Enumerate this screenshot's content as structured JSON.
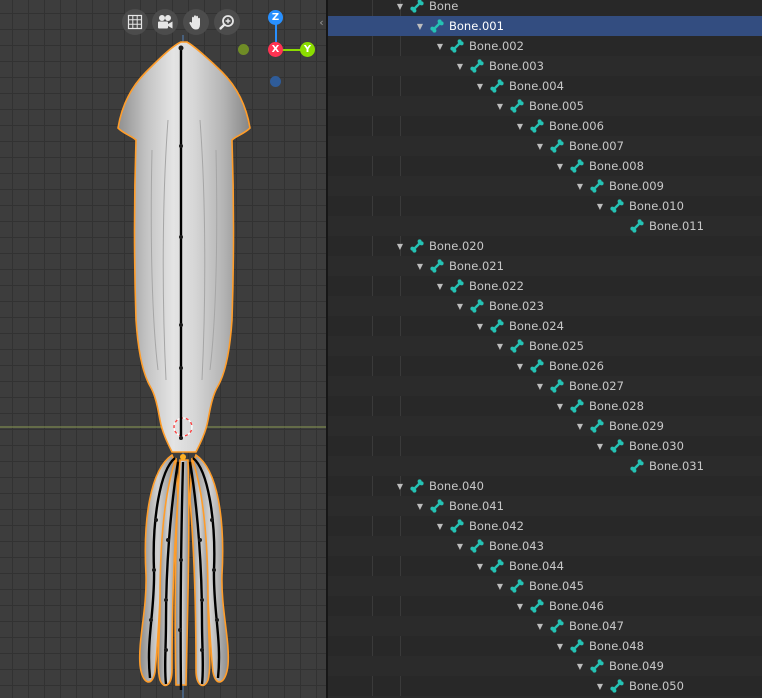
{
  "viewport": {
    "nav_icons": [
      "grid-icon",
      "camera-icon",
      "hand-pan-icon",
      "zoom-icon"
    ],
    "gizmo": {
      "z": "Z",
      "x": "X",
      "y": "Y"
    },
    "colors": {
      "outline": "#ff9d2a",
      "axis_x": "#ff3352",
      "axis_y": "#8bdc00",
      "axis_z": "#2890ff",
      "horizon": "#8a9a54"
    }
  },
  "outliner": {
    "icon": "bone-icon",
    "icon_color": "#25c2b4",
    "selected_bone": "Bone.001",
    "rows": [
      {
        "label": "Bone",
        "depth": 0
      },
      {
        "label": "Bone.001",
        "depth": 1
      },
      {
        "label": "Bone.002",
        "depth": 2
      },
      {
        "label": "Bone.003",
        "depth": 3
      },
      {
        "label": "Bone.004",
        "depth": 4
      },
      {
        "label": "Bone.005",
        "depth": 5
      },
      {
        "label": "Bone.006",
        "depth": 6
      },
      {
        "label": "Bone.007",
        "depth": 7
      },
      {
        "label": "Bone.008",
        "depth": 8
      },
      {
        "label": "Bone.009",
        "depth": 9
      },
      {
        "label": "Bone.010",
        "depth": 10
      },
      {
        "label": "Bone.011",
        "depth": 11
      },
      {
        "label": "Bone.020",
        "depth": 0
      },
      {
        "label": "Bone.021",
        "depth": 1
      },
      {
        "label": "Bone.022",
        "depth": 2
      },
      {
        "label": "Bone.023",
        "depth": 3
      },
      {
        "label": "Bone.024",
        "depth": 4
      },
      {
        "label": "Bone.025",
        "depth": 5
      },
      {
        "label": "Bone.026",
        "depth": 6
      },
      {
        "label": "Bone.027",
        "depth": 7
      },
      {
        "label": "Bone.028",
        "depth": 8
      },
      {
        "label": "Bone.029",
        "depth": 9
      },
      {
        "label": "Bone.030",
        "depth": 10
      },
      {
        "label": "Bone.031",
        "depth": 11
      },
      {
        "label": "Bone.040",
        "depth": 0
      },
      {
        "label": "Bone.041",
        "depth": 1
      },
      {
        "label": "Bone.042",
        "depth": 2
      },
      {
        "label": "Bone.043",
        "depth": 3
      },
      {
        "label": "Bone.044",
        "depth": 4
      },
      {
        "label": "Bone.045",
        "depth": 5
      },
      {
        "label": "Bone.046",
        "depth": 6
      },
      {
        "label": "Bone.047",
        "depth": 7
      },
      {
        "label": "Bone.048",
        "depth": 8
      },
      {
        "label": "Bone.049",
        "depth": 9
      },
      {
        "label": "Bone.050",
        "depth": 10
      },
      {
        "label": "",
        "depth": 11
      }
    ]
  }
}
